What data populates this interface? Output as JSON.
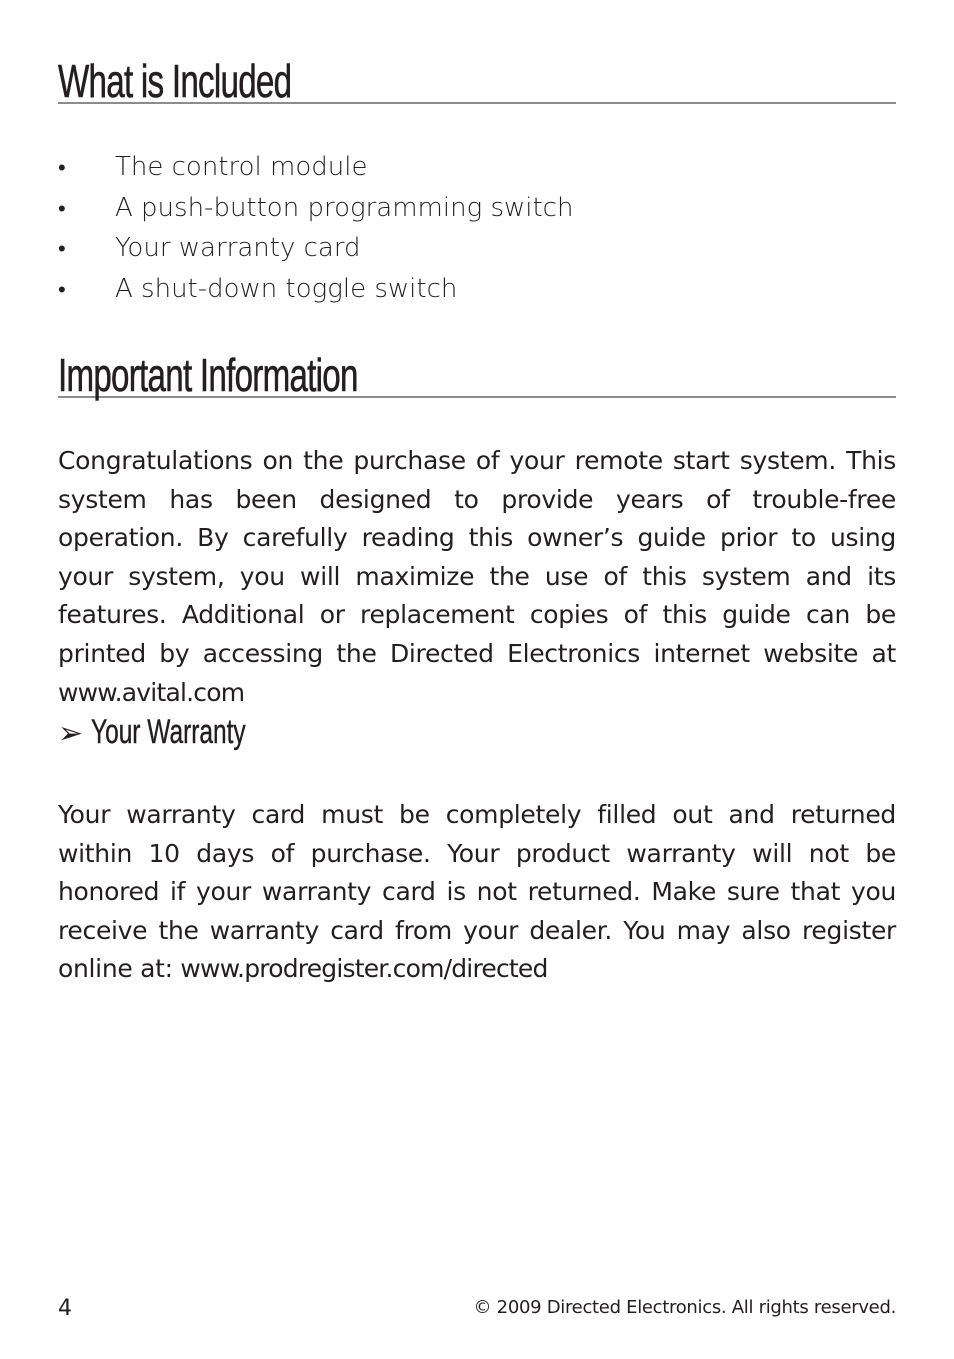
{
  "sections": {
    "included": {
      "title": "What is Included",
      "items": [
        "The control module",
        "A push-button programming switch",
        "Your warranty card",
        "A shut-down toggle switch"
      ],
      "bullet": "•"
    },
    "important": {
      "title": "Important Information",
      "body": "Congratulations on the purchase of your remote start system. This system has been designed to provide years of trouble-free operation. By carefully reading this owner’s guide prior to using your system, you will maximize the use of this system and its features. Additional or replacement copies of this guide can be printed by accessing the Directed Electronics internet website at ",
      "link": "www.avital.com"
    },
    "warranty": {
      "arrow_icon": "➢",
      "title": "Your Warranty",
      "body": "Your warranty card must be completely filled out and returned within 10 days of purchase. Your product warranty will not be honored if your warranty card is not returned. Make sure that you receive the warranty card from your dealer. You may also register online at: ",
      "link": "www.prodregister.com/directed"
    }
  },
  "footer": {
    "page_number": "4",
    "copyright": "© 2009 Directed Electronics. All rights reserved."
  }
}
